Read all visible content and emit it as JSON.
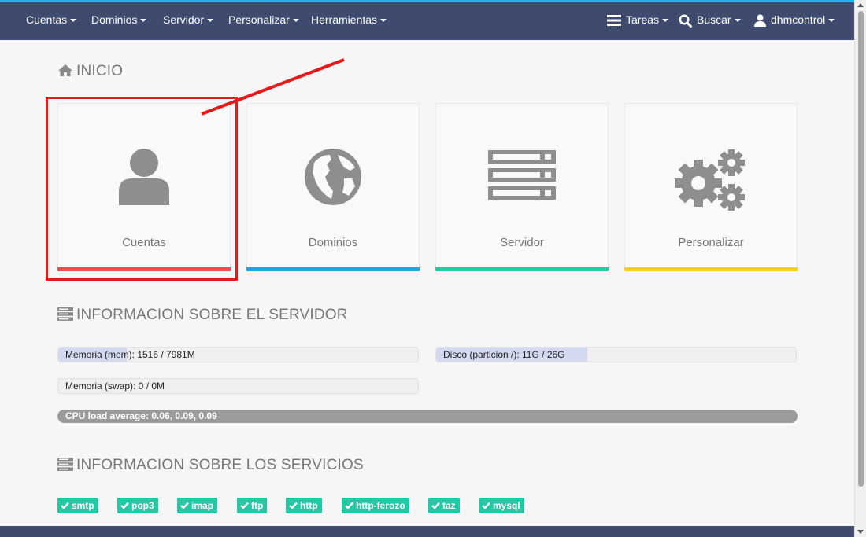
{
  "nav": {
    "left": [
      {
        "label": "Cuentas"
      },
      {
        "label": "Dominios"
      },
      {
        "label": "Servidor"
      },
      {
        "label": "Personalizar"
      },
      {
        "label": "Herramientas"
      }
    ],
    "tasks_label": "Tareas",
    "search_label": "Buscar",
    "user_label": "dhmcontrol"
  },
  "home": {
    "title": "INICIO",
    "cards": [
      {
        "label": "Cuentas",
        "icon": "user-icon",
        "color": "#f44a4a"
      },
      {
        "label": "Dominios",
        "icon": "globe-icon",
        "color": "#1ba6ec"
      },
      {
        "label": "Servidor",
        "icon": "server-icon",
        "color": "#1ecfa6"
      },
      {
        "label": "Personalizar",
        "icon": "gears-icon",
        "color": "#f5cf1c"
      }
    ]
  },
  "server_info": {
    "title": "INFORMACION SOBRE EL SERVIDOR",
    "memory": {
      "label": "Memoria (mem): 1516 / 7981M",
      "fraction": 0.19
    },
    "disk": {
      "label": "Disco (particion /): 11G / 26G",
      "fraction": 0.42
    },
    "swap": {
      "label": "Memoria (swap): 0 / 0M",
      "fraction": 0.0
    },
    "cpu": {
      "label": "CPU load average: 0.06, 0.09, 0.09",
      "fraction": 1.0
    }
  },
  "services": {
    "title": "INFORMACION SOBRE LOS SERVICIOS",
    "items": [
      "smtp",
      "pop3",
      "imap",
      "ftp",
      "http",
      "http-ferozo",
      "taz",
      "mysql"
    ],
    "color": "#22c9a2"
  }
}
